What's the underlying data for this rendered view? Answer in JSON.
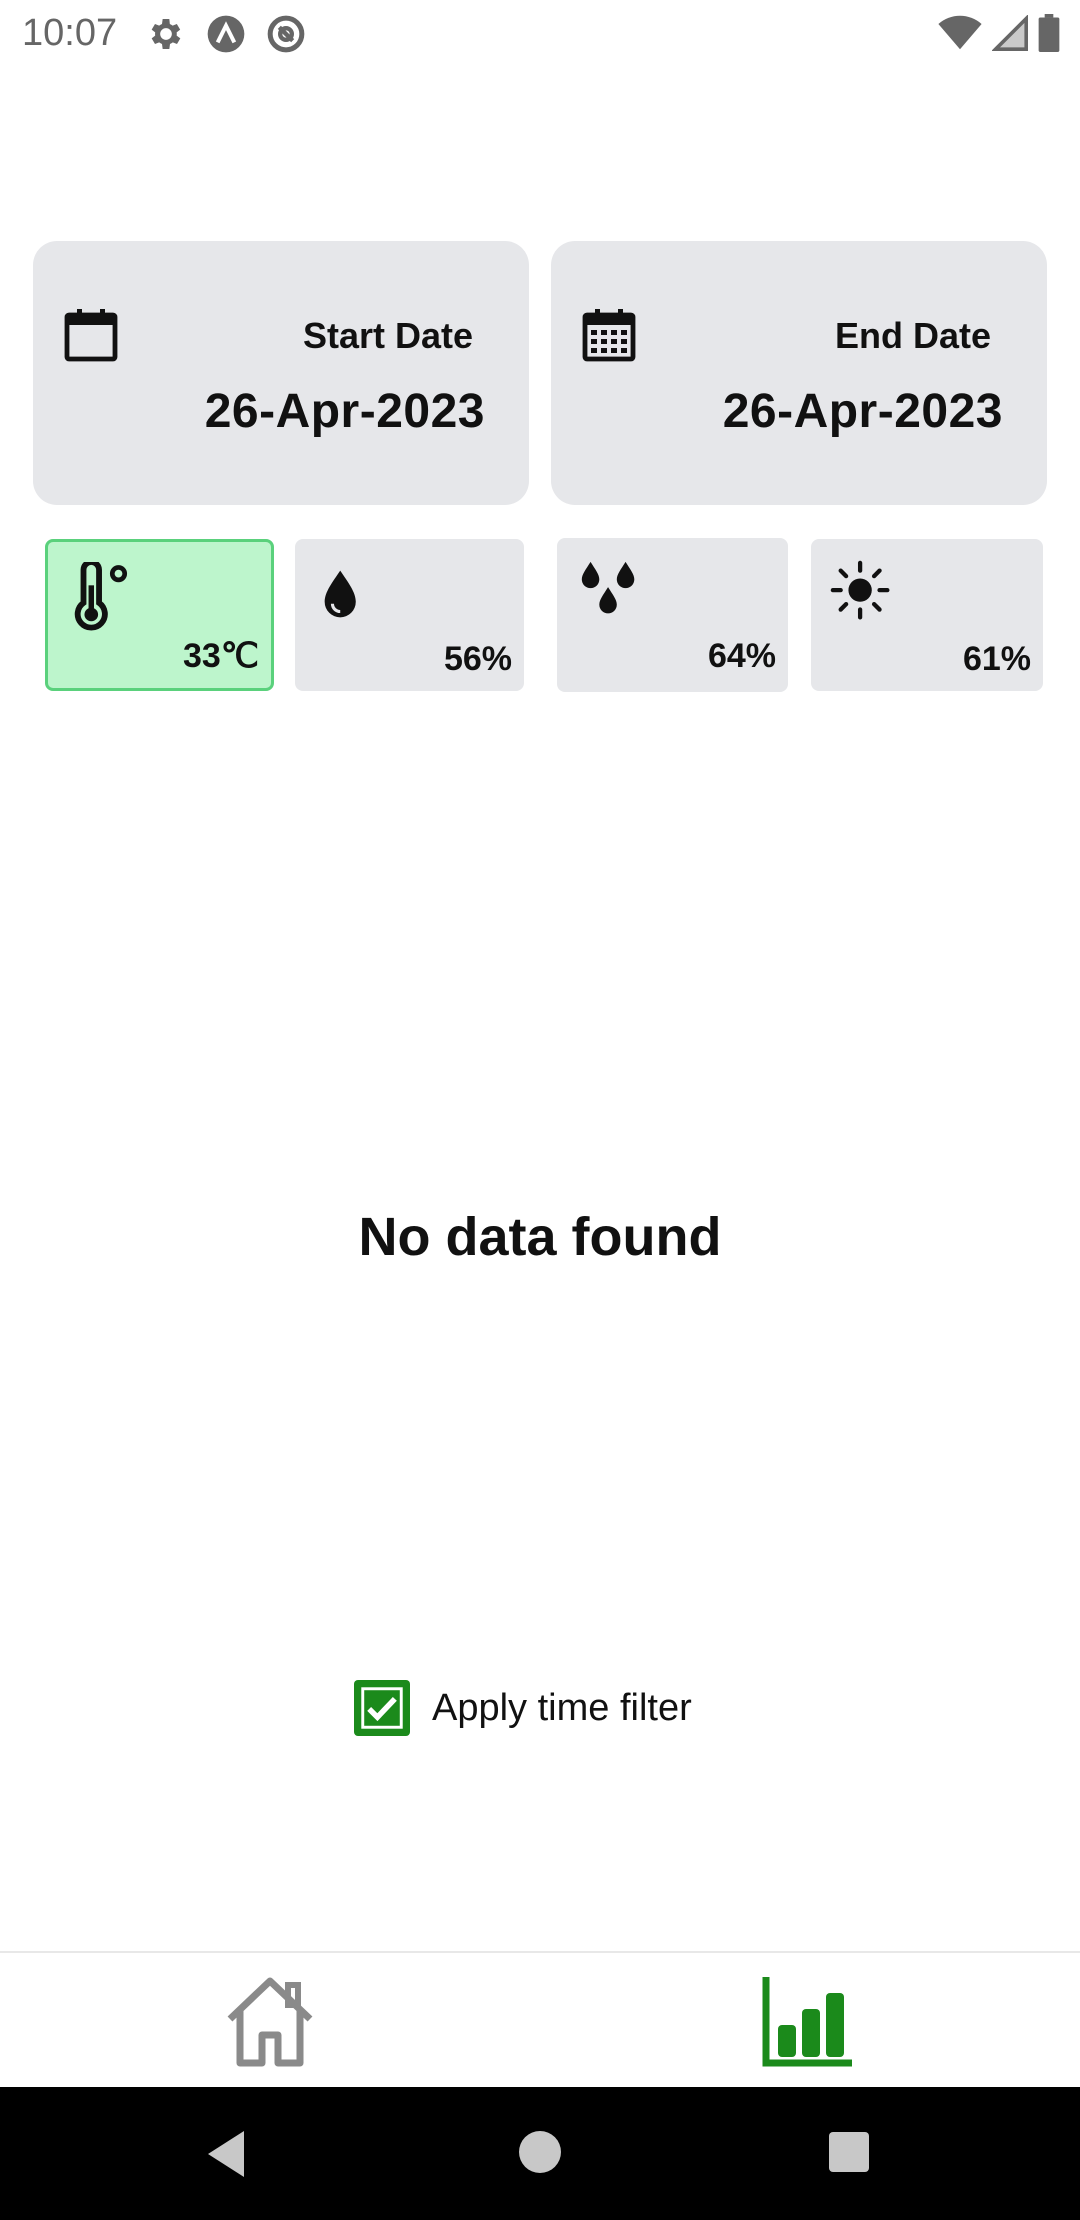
{
  "status_bar": {
    "time": "10:07",
    "left_icons": [
      "gear-icon",
      "a-circle-icon",
      "at-circle-icon"
    ],
    "right_icons": [
      "wifi-icon",
      "signal-icon",
      "battery-icon"
    ]
  },
  "dates": {
    "start": {
      "label": "Start Date",
      "value": "26-Apr-2023",
      "icon": "calendar-icon"
    },
    "end": {
      "label": "End Date",
      "value": "26-Apr-2023",
      "icon": "calendar-grid-icon"
    }
  },
  "metrics": [
    {
      "icon": "thermometer-icon",
      "value": "33℃",
      "active": true
    },
    {
      "icon": "water-drop-icon",
      "value": "56%",
      "active": false
    },
    {
      "icon": "rain-drops-icon",
      "value": "64%",
      "active": false
    },
    {
      "icon": "sun-icon",
      "value": "61%",
      "active": false
    }
  ],
  "main": {
    "empty_message": "No data found"
  },
  "filter": {
    "label": "Apply time filter",
    "checked": true
  },
  "bottom_nav": {
    "items": [
      {
        "icon": "home-icon",
        "active": false
      },
      {
        "icon": "bar-chart-icon",
        "active": true
      }
    ]
  },
  "colors": {
    "accent": "#1b8a1b",
    "active_tile_bg": "#bdf5cc",
    "active_tile_border": "#5ad17c",
    "card_bg": "#e6e7ea"
  }
}
